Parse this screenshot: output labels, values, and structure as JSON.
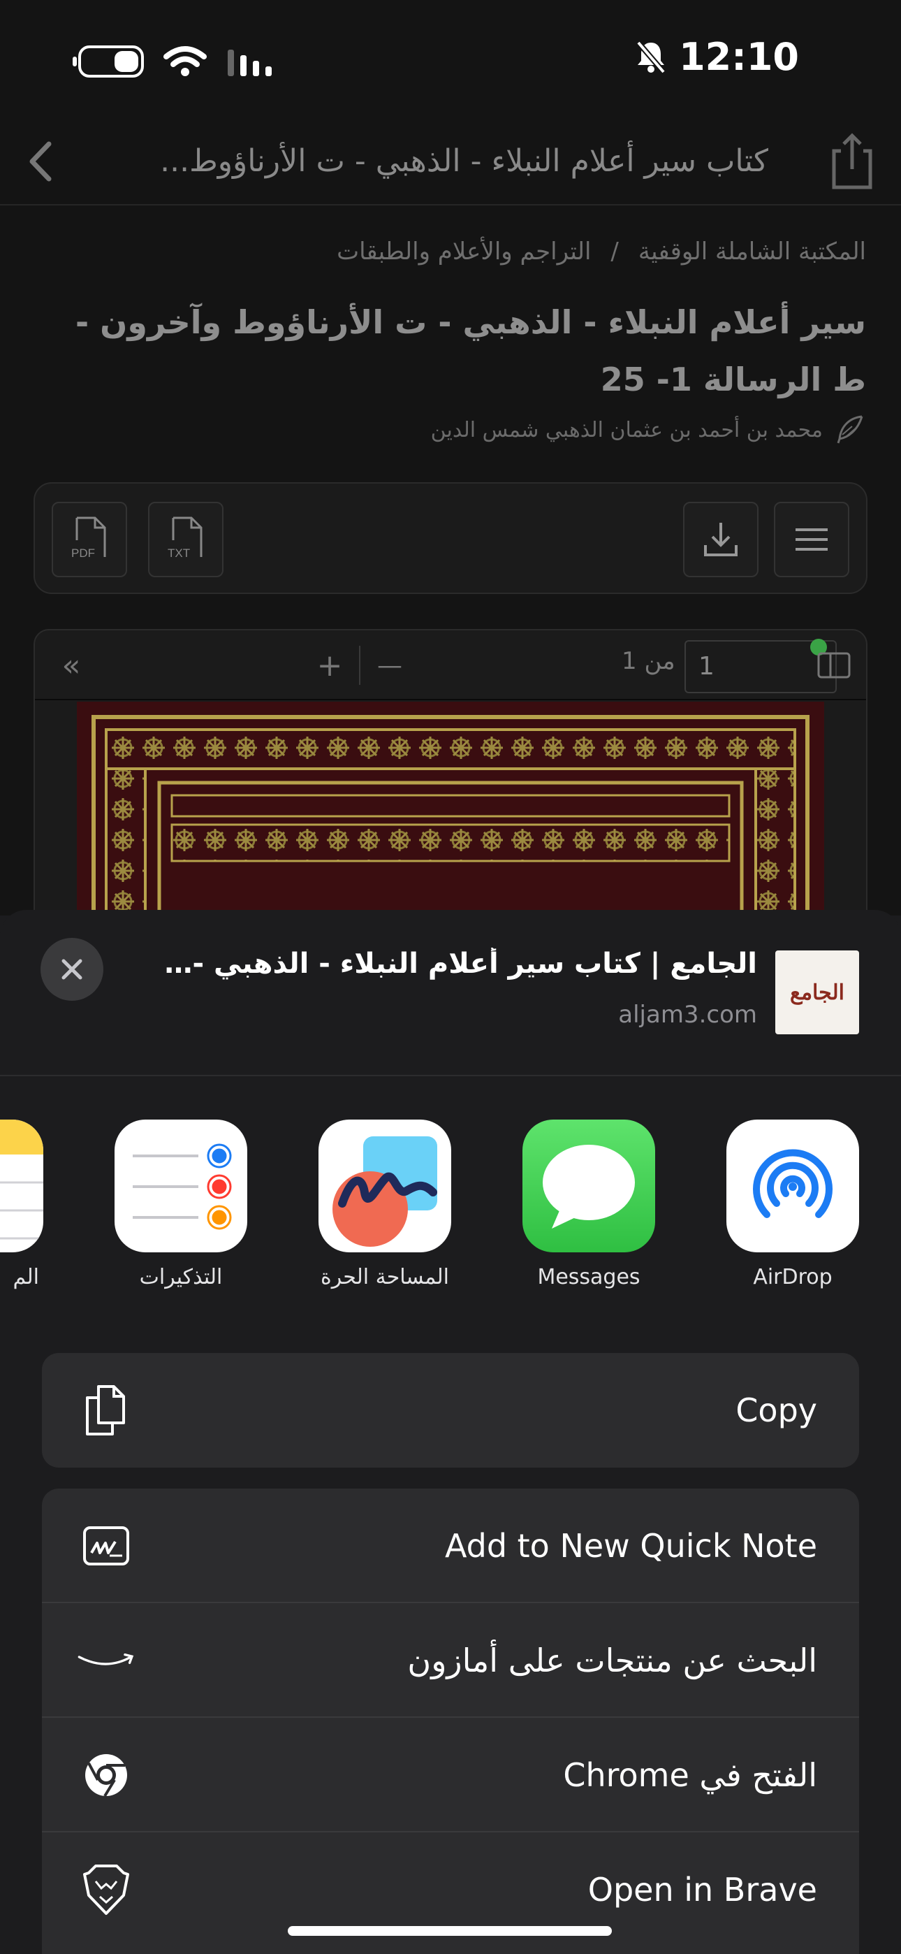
{
  "status_bar": {
    "time": "12:10"
  },
  "nav": {
    "title": "كتاب سير أعلام النبلاء - الذهبي - ت الأرناؤوط..."
  },
  "breadcrumb": {
    "library": "المكتبة الشاملة الوقفية",
    "separator": "/",
    "category": "التراجم والأعلام والطبقات"
  },
  "book": {
    "title": "سير أعلام النبلاء - الذهبي - ت الأرناؤوط وآخرون - ط الرسالة 1- 25",
    "author": "محمد بن أحمد بن عثمان الذهبي شمس الدين"
  },
  "toolbar": {
    "pdf_label": "PDF",
    "txt_label": "TXT"
  },
  "viewer": {
    "page_value": "1",
    "page_of": "من 1",
    "zoom_in": "+",
    "zoom_out": "—",
    "collapse": "«"
  },
  "share_sheet": {
    "site_title": "الجامع | كتاب سير أعلام النبلاء - الذهبي - ت...",
    "site_url": "aljam3.com",
    "site_logo_text": "الجامع",
    "apps": [
      {
        "label": "AirDrop",
        "icon": "airdrop-icon"
      },
      {
        "label": "Messages",
        "icon": "messages-icon"
      },
      {
        "label": "المساحة الحرة",
        "icon": "freeform-icon"
      },
      {
        "label": "التذكيرات",
        "icon": "reminders-icon"
      },
      {
        "label": "الم",
        "icon": "notes-icon"
      }
    ],
    "copy_label": "Copy",
    "actions": [
      {
        "label": "Add to New Quick Note",
        "icon": "quick-note-icon"
      },
      {
        "label": "البحث عن منتجات على أمازون",
        "icon": "amazon-icon"
      },
      {
        "label": "الفتح في Chrome",
        "icon": "chrome-icon"
      },
      {
        "label": "Open in Brave",
        "icon": "brave-icon"
      }
    ]
  },
  "colors": {
    "sheet_bg": "#1c1c1e",
    "row_bg": "#2c2c2e",
    "messages_green": "#34c759",
    "airdrop_blue": "#1c7cf4"
  }
}
